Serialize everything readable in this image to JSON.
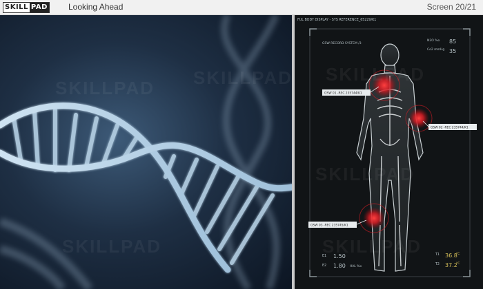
{
  "header": {
    "logo_left": "SKILL",
    "logo_right": "PAD",
    "title": "Looking Ahead",
    "screen_counter": "Screen 20/21"
  },
  "dna_image": {
    "watermark": "SKILLPAD"
  },
  "body_display": {
    "title": "FUL BODY DISPLAY - SYS REFERENCE_65229/K1",
    "system_label": "GSW RECORD SYSTEM /3",
    "watermark": "SKILLPAD",
    "readout_top": [
      {
        "label": "N2O %o",
        "value": "85"
      },
      {
        "label": "Co2 mmHg",
        "value": "35"
      }
    ],
    "callouts": [
      {
        "text": "GSW 01 -REC 235744/K1"
      },
      {
        "text": "GSW 02 -REC 235744/K1"
      },
      {
        "text": "GSW 03 -REC 235745/K1"
      }
    ],
    "readout_bottom_left": [
      {
        "label": "E1",
        "value": "1.50"
      },
      {
        "label": "E2",
        "value": "1.80",
        "extra": "HAL %o"
      }
    ],
    "readout_bottom_right": [
      {
        "label": "T1",
        "value": "36.8",
        "unit": "°C"
      },
      {
        "label": "T2",
        "value": "37.2",
        "unit": "°C"
      }
    ],
    "colors": {
      "highlight": "#e0202a",
      "temperature": "#d8c25a",
      "hud": "#b8c4c8"
    }
  }
}
